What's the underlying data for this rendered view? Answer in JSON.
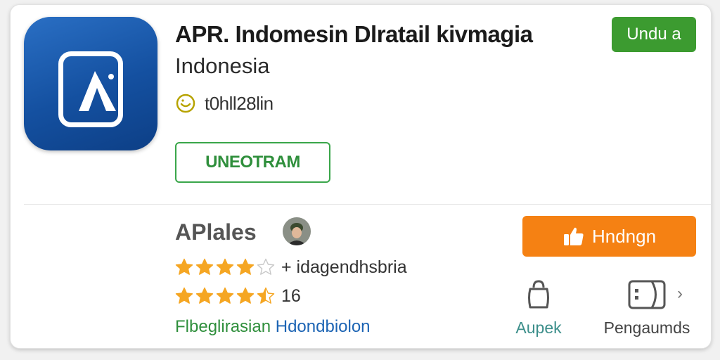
{
  "app": {
    "title": "APR. Indomesin Dlratail kivmagia",
    "subtitle": "Indonesia",
    "meta_text": "t0hll28lin",
    "outline_button_label": "UNEOTRAM",
    "top_button_label": "Undu a"
  },
  "developer": {
    "name": "APlales",
    "rating_row_1_text": "+ idagendhsbria",
    "rating_row_1_stars": 4,
    "rating_row_2_text": "16",
    "rating_row_2_stars": 4.5,
    "category_1": "Flbeglirasian",
    "category_2": "Hdondbiolon"
  },
  "actions": {
    "primary_label": "Hndngn",
    "action_1_label": "Aupek",
    "action_2_label": "Pengaumds"
  },
  "colors": {
    "app_icon_blue": "#1450a0",
    "green": "#3c9b30",
    "orange": "#f58113",
    "star": "#f5a623",
    "link_blue": "#1c64b4"
  },
  "icons": {
    "app": "app-logo-icon",
    "meta": "smile-icon",
    "thumb": "thumbs-up-icon",
    "action_1": "bag-icon",
    "action_2": "window-icon",
    "chevron": "chevron-right-icon"
  }
}
